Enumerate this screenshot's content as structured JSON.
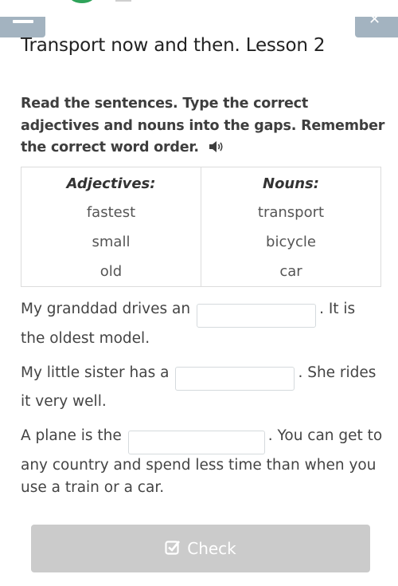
{
  "header": {
    "minimize_icon": "minus-icon",
    "close_icon": "close-icon"
  },
  "lesson": {
    "title": "Transport now and then. Lesson 2"
  },
  "instructions": {
    "text": "Read the sentences. Type the correct adjectives and nouns into the gaps. Remember the correct word order.",
    "audio_icon": "speaker-icon"
  },
  "word_table": {
    "headers": [
      "Adjectives:",
      "Nouns:"
    ],
    "rows": [
      [
        "fastest",
        "transport"
      ],
      [
        "small",
        "bicycle"
      ],
      [
        "old",
        "car"
      ]
    ]
  },
  "sentences": [
    {
      "before": "My granddad drives an",
      "gap_value": "",
      "after": ". It is the oldest model."
    },
    {
      "before": "My little sister has a",
      "gap_value": "",
      "after": ". She rides it very well."
    },
    {
      "before": "A plane is the",
      "gap_value": "",
      "after": ". You can get to any country and spend less time than when you use a train or a car."
    }
  ],
  "check_button": {
    "label": "Check",
    "icon": "checkbox-icon",
    "disabled": true
  }
}
